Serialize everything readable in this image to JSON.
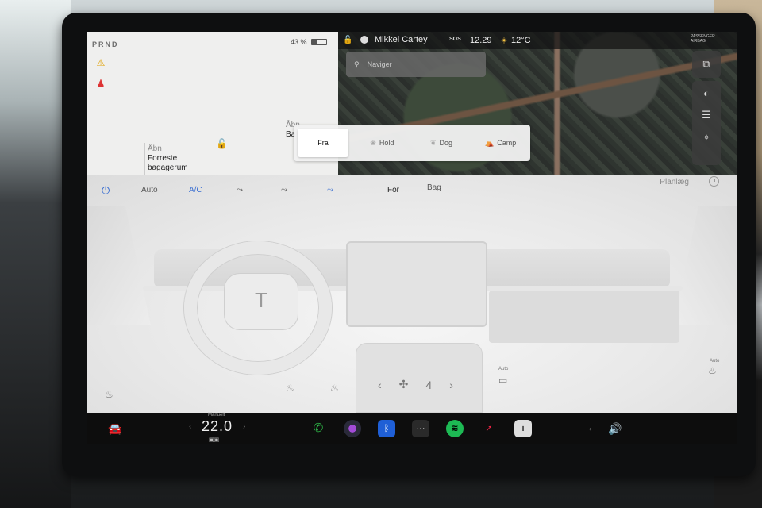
{
  "status": {
    "gear": "PRND",
    "battery_percent": "43 %",
    "battery_level": 0.43,
    "user_name": "Mikkel Cartey",
    "sos_label": "SOS",
    "time": "12.29",
    "temperature": "12°C",
    "airbag_label": "PASSENGER AIRBAG"
  },
  "car": {
    "front_trunk": {
      "action": "Åbn",
      "name": "Forreste bagagerum"
    },
    "rear_trunk": {
      "action": "Åbn",
      "name": "Ba"
    }
  },
  "map": {
    "search_placeholder": "Naviger",
    "side_icons": [
      "map-layers-icon",
      "compass-icon",
      "menu-icon",
      "pin-icon"
    ]
  },
  "fan_modes": {
    "items": [
      "Fra",
      "Hold",
      "Dog",
      "Camp"
    ],
    "selected": "Fra"
  },
  "climate": {
    "auto": "Auto",
    "ac": "A/C",
    "front": "For",
    "rear": "Bag",
    "schedule": "Planlæg",
    "fan_speed": "4",
    "auto_small": "Auto",
    "auto_small_2": "Auto",
    "accent_color": "#3b6fd1"
  },
  "dock": {
    "temp_mode": "Manuelt",
    "temp_value": "22.0",
    "apps": [
      "phone-icon",
      "camera-icon",
      "bluetooth-icon",
      "more-icon",
      "spotify-icon",
      "navigation-icon",
      "info-icon"
    ]
  }
}
